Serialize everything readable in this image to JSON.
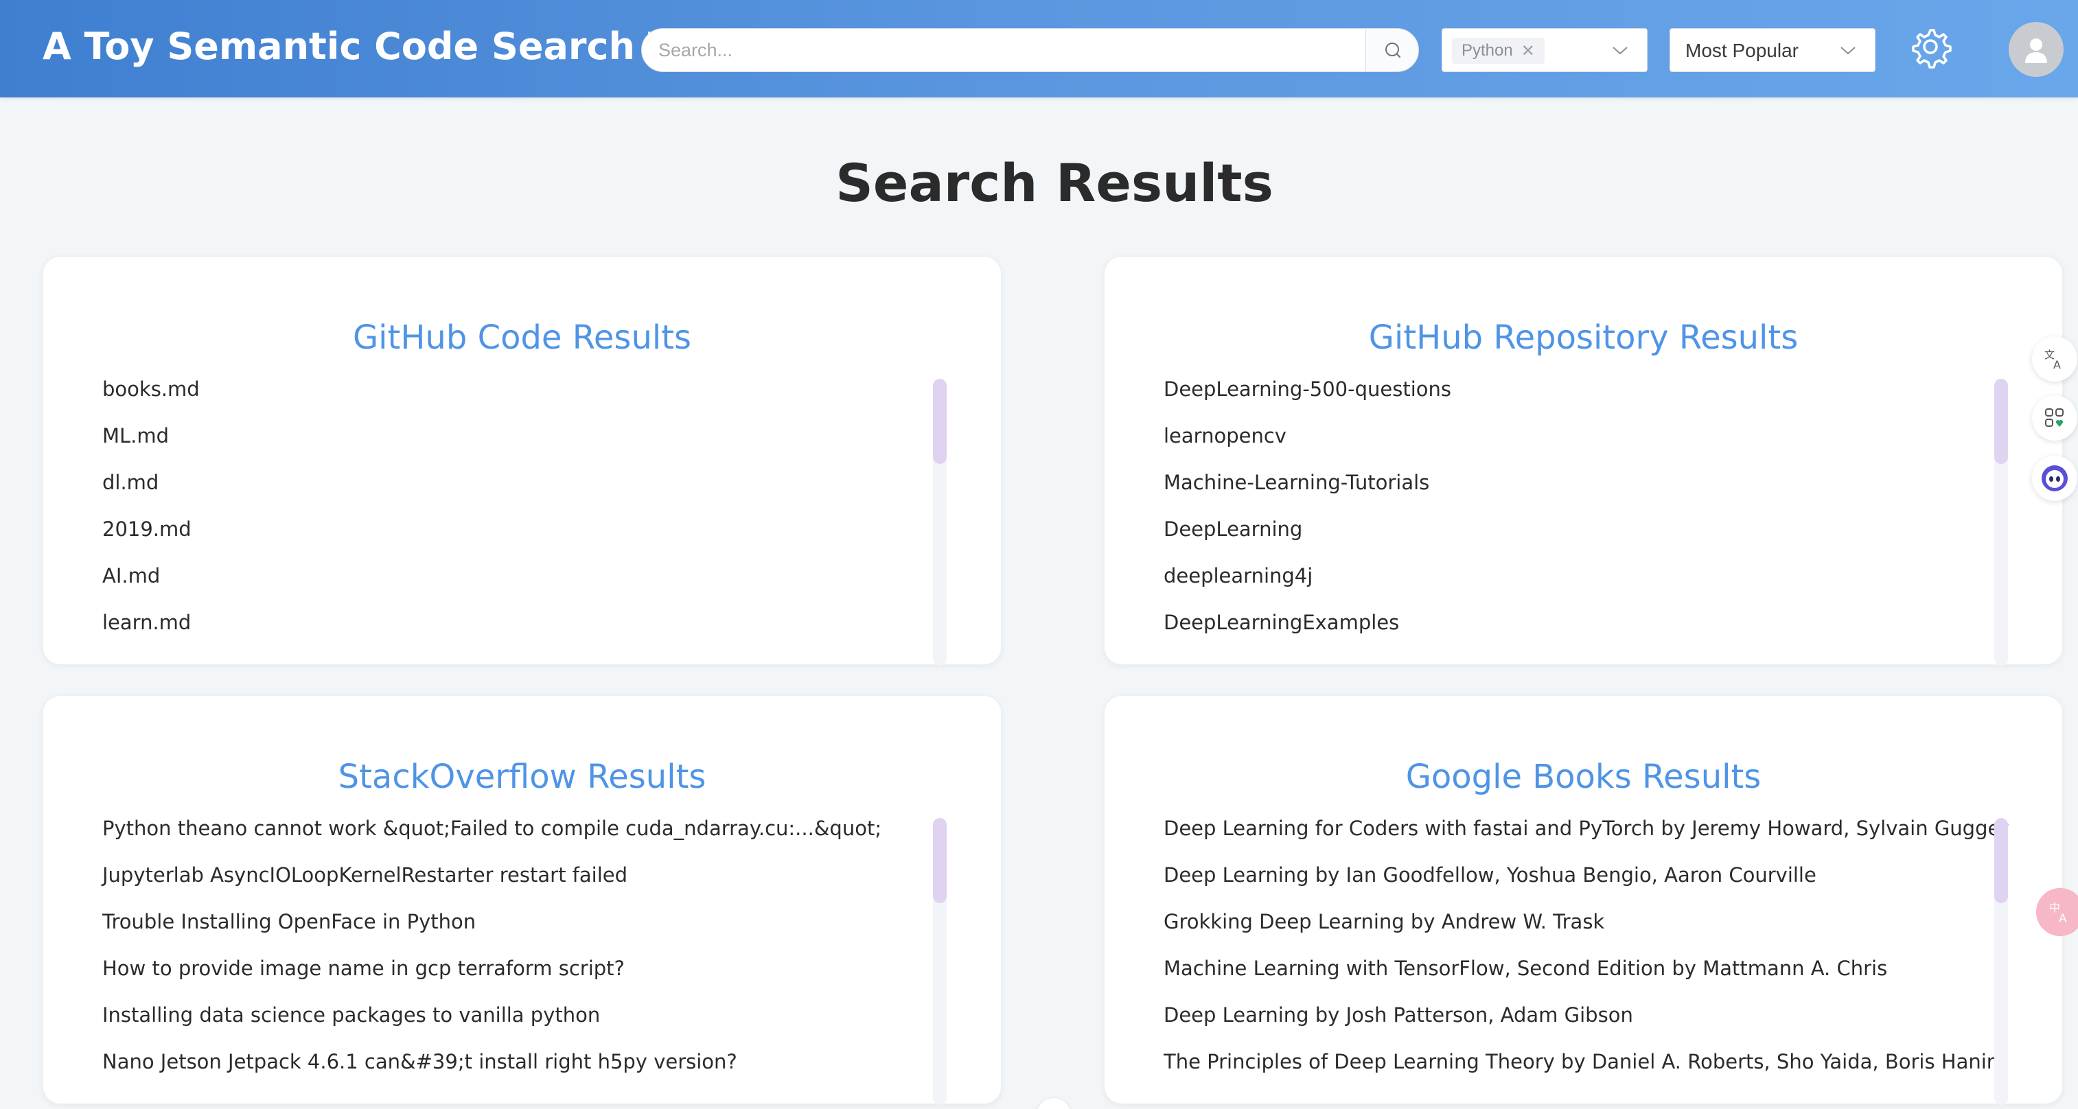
{
  "header": {
    "title": "A Toy Semantic Code Search Tool",
    "search_placeholder": "Search...",
    "language_tag": "Python",
    "sort_value": "Most Popular"
  },
  "page_title": "Search Results",
  "cards": {
    "github_code": {
      "title": "GitHub Code Results",
      "items": [
        "books.md",
        "ML.md",
        "dl.md",
        "2019.md",
        "AI.md",
        "learn.md"
      ]
    },
    "github_repo": {
      "title": "GitHub Repository Results",
      "items": [
        "DeepLearning-500-questions",
        "learnopencv",
        "Machine-Learning-Tutorials",
        "DeepLearning",
        "deeplearning4j",
        "DeepLearningExamples"
      ]
    },
    "stackoverflow": {
      "title": "StackOverflow Results",
      "items": [
        "Python theano cannot work &quot;Failed to compile cuda_ndarray.cu:...&quot;",
        "Jupyterlab AsyncIOLoopKernelRestarter restart failed",
        "Trouble Installing OpenFace in Python",
        "How to provide image name in gcp terraform script?",
        "Installing data science packages to vanilla python",
        "Nano Jetson Jetpack 4.6.1 can&#39;t install right h5py version?"
      ]
    },
    "google_books": {
      "title": "Google Books Results",
      "items": [
        "Deep Learning for Coders with fastai and PyTorch by Jeremy Howard, Sylvain Gugger",
        "Deep Learning by Ian Goodfellow, Yoshua Bengio, Aaron Courville",
        "Grokking Deep Learning by Andrew W. Trask",
        "Machine Learning with TensorFlow, Second Edition by Mattmann A. Chris",
        "Deep Learning by Josh Patterson, Adam Gibson",
        "The Principles of Deep Learning Theory by Daniel A. Roberts, Sho Yaida, Boris Hanin"
      ]
    }
  },
  "icons": {
    "search": "search-icon",
    "chevron": "chevron-down-icon",
    "settings": "gear-icon",
    "avatar": "user-avatar-icon",
    "translate": "translate-icon",
    "apps": "apps-icon",
    "assistant": "assistant-icon"
  },
  "colors": {
    "header_start": "#3f7fd0",
    "header_end": "#6aa6ea",
    "card_title": "#4f94e6",
    "scroll_thumb": "#e0d3f2"
  }
}
